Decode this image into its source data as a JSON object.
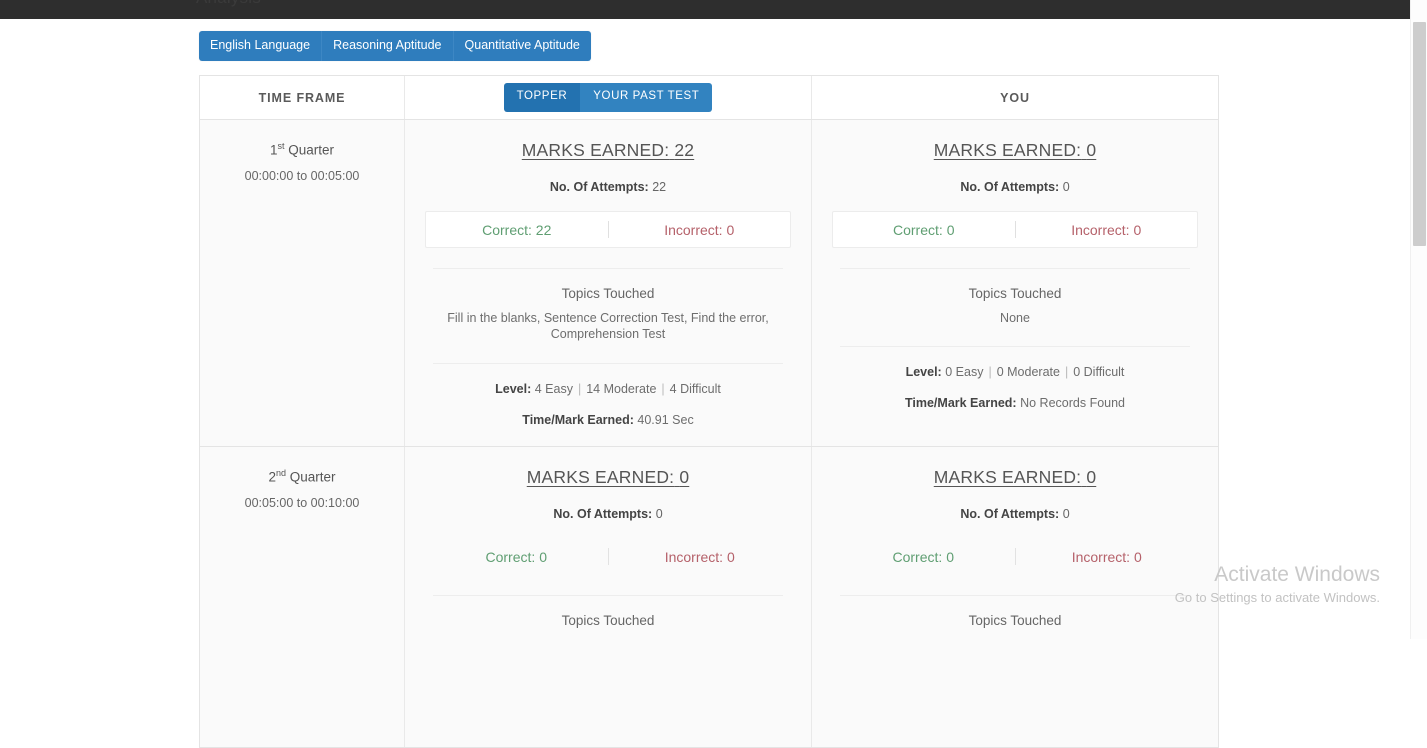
{
  "navbar": {
    "title_partial": "Analysis"
  },
  "subject_tabs": [
    {
      "label": "English Language",
      "active": true
    },
    {
      "label": "Reasoning Aptitude",
      "active": false
    },
    {
      "label": "Quantitative Aptitude",
      "active": false
    }
  ],
  "table": {
    "headers": {
      "time_frame": "TIME FRAME",
      "you": "YOU"
    },
    "source_toggle": [
      {
        "label": "TOPPER",
        "active": true
      },
      {
        "label": "YOUR PAST TEST",
        "active": false
      }
    ]
  },
  "labels": {
    "marks_earned": "MARKS EARNED:",
    "attempts": "No. Of Attempts:",
    "correct": "Correct:",
    "incorrect": "Incorrect:",
    "topics_touched": "Topics Touched",
    "level": "Level:",
    "time_per_mark": "Time/Mark Earned:",
    "sep": "|",
    "easy_suffix": "Easy",
    "moderate_suffix": "Moderate",
    "difficult_suffix": "Difficult"
  },
  "rows": [
    {
      "quarter_number": "1",
      "quarter_ordinal": "st",
      "quarter_word": "Quarter",
      "time_range": "00:00:00 to 00:05:00",
      "topper": {
        "marks_earned": "22",
        "attempts": "22",
        "correct": "22",
        "incorrect": "0",
        "topics": "Fill in the blanks, Sentence Correction Test, Find the error, Comprehension Test",
        "easy": "4",
        "moderate": "14",
        "difficult": "4",
        "time_per_mark": "40.91 Sec"
      },
      "you": {
        "marks_earned": "0",
        "attempts": "0",
        "correct": "0",
        "incorrect": "0",
        "topics": "None",
        "easy": "0",
        "moderate": "0",
        "difficult": "0",
        "time_per_mark": "No Records Found"
      }
    },
    {
      "quarter_number": "2",
      "quarter_ordinal": "nd",
      "quarter_word": "Quarter",
      "time_range": "00:05:00 to 00:10:00",
      "topper": {
        "marks_earned": "0",
        "attempts": "0",
        "correct": "0",
        "incorrect": "0",
        "topics": "",
        "easy": "",
        "moderate": "",
        "difficult": "",
        "time_per_mark": ""
      },
      "you": {
        "marks_earned": "0",
        "attempts": "0",
        "correct": "0",
        "incorrect": "0",
        "topics": "",
        "easy": "",
        "moderate": "",
        "difficult": "",
        "time_per_mark": ""
      }
    }
  ],
  "watermark": {
    "title": "Activate Windows",
    "subtitle": "Go to Settings to activate Windows."
  },
  "colors": {
    "accent_blue": "#2f7dbd",
    "accent_blue_active": "#2372b0",
    "correct_green": "#5f9e72",
    "incorrect_red": "#b5616a",
    "navbar_dark": "#2e2e2e"
  }
}
